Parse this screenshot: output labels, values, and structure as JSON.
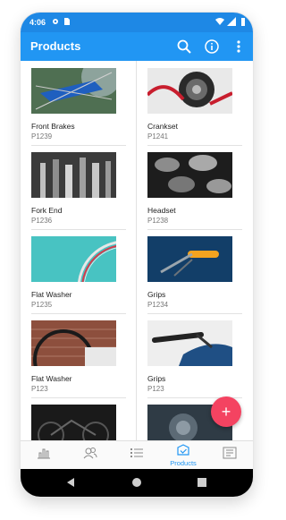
{
  "status_bar": {
    "time": "4:06"
  },
  "app_bar": {
    "title": "Products"
  },
  "products": [
    {
      "name": "Front Brakes",
      "code": "P1239"
    },
    {
      "name": "Crankset",
      "code": "P1241"
    },
    {
      "name": "Fork End",
      "code": "P1236"
    },
    {
      "name": "Headset",
      "code": "P1238"
    },
    {
      "name": "Flat Washer",
      "code": "P1235"
    },
    {
      "name": "Grips",
      "code": "P1234"
    },
    {
      "name": "Flat Washer",
      "code": "P123"
    },
    {
      "name": "Grips",
      "code": "P123"
    }
  ],
  "fab": {
    "icon": "+"
  },
  "bottom_nav": {
    "active_label": "Products"
  },
  "colors": {
    "primary": "#2196f3",
    "statusbar": "#1e88e5",
    "fab": "#f44361"
  }
}
